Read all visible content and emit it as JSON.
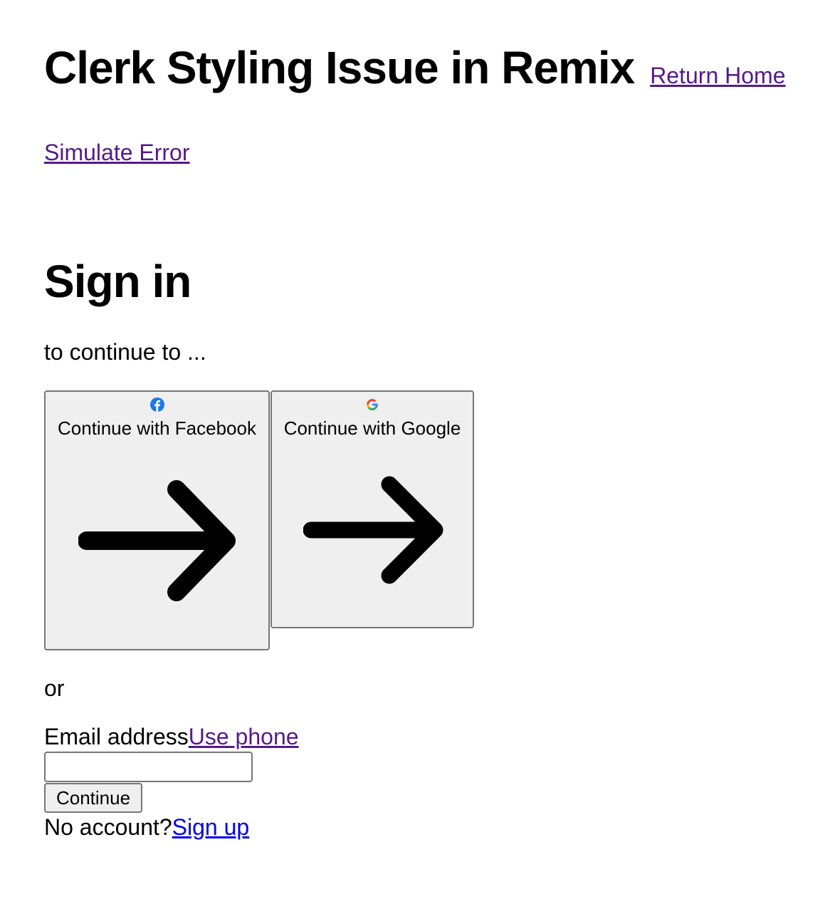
{
  "header": {
    "title": "Clerk Styling Issue in Remix",
    "return_home": "Return Home"
  },
  "simulate_error": "Simulate Error",
  "sign_in": {
    "title": "Sign in",
    "subtitle": "to continue to ...",
    "social_buttons": [
      {
        "label": "Continue with Facebook",
        "icon": "facebook-icon",
        "icon_color": "#1877f2"
      },
      {
        "label": "Continue with Google",
        "icon": "google-icon",
        "icon_colors": [
          "#4285f4",
          "#ea4335",
          "#fbbc05",
          "#34a853"
        ]
      }
    ],
    "divider": "or",
    "email_label": "Email address",
    "use_phone": "Use phone",
    "email_value": "",
    "continue_label": "Continue",
    "no_account": "No account?",
    "sign_up": "Sign up"
  },
  "colors": {
    "visited_link": "#551a8b",
    "link": "#0000ee",
    "button_bg": "#efefef",
    "button_border": "#767676"
  }
}
